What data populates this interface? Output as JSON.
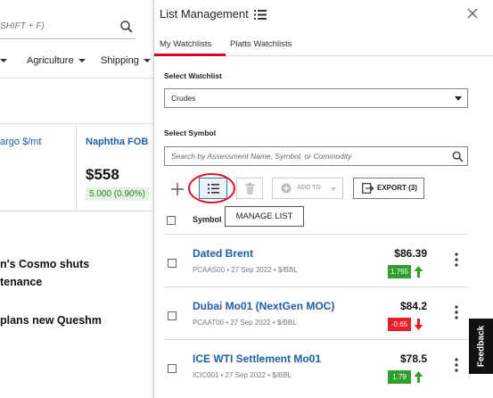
{
  "background": {
    "search_placeholder": "SHIFT + F)",
    "nav_items": [
      "Agriculture",
      "Shipping"
    ],
    "card1_title": "argo $/mt",
    "card2_title": "Naphtha FOB",
    "card2_price": "$558",
    "card2_change": "5.000 (0.90%)",
    "news1_line1": "n's Cosmo shuts",
    "news1_line2": "tenance",
    "news2_line1": "plans new Queshm"
  },
  "panel": {
    "title": "List Management",
    "tabs": [
      {
        "label": "My Watchlists",
        "active": true
      },
      {
        "label": "Platts Watchlists",
        "active": false
      }
    ],
    "select_watchlist_label": "Select Watchlist",
    "select_watchlist_value": "Crudes",
    "select_symbol_label": "Select Symbol",
    "search_placeholder": "Search by Assessment Name, Symbol, or Commodity",
    "toolbar": {
      "add_to_label": "ADD TO",
      "export_label": "EXPORT (3)"
    },
    "tooltip": "MANAGE LIST",
    "column_symbol": "Symbol",
    "rows": [
      {
        "name": "Dated Brent",
        "meta": "PCAAS00 • 27 Sep 2022 • $/BBL",
        "price": "$86.39",
        "change": "1.765",
        "direction": "up"
      },
      {
        "name": "Dubai Mo01 (NextGen MOC)",
        "meta": "PCAAT00 • 27 Sep 2022 • $/BBL",
        "price": "$84.2",
        "change": "-0.65",
        "direction": "down"
      },
      {
        "name": "ICE WTI Settlement Mo01",
        "meta": "ICIC001 • 27 Sep 2022 • $/BBL",
        "price": "$78.5",
        "change": "1.79",
        "direction": "up"
      }
    ]
  },
  "feedback_label": "Feedback",
  "colors": {
    "accent_red": "#d6002a",
    "link_blue": "#1f5ea8",
    "up_green": "#2ea02e",
    "down_red": "#e8202a"
  }
}
